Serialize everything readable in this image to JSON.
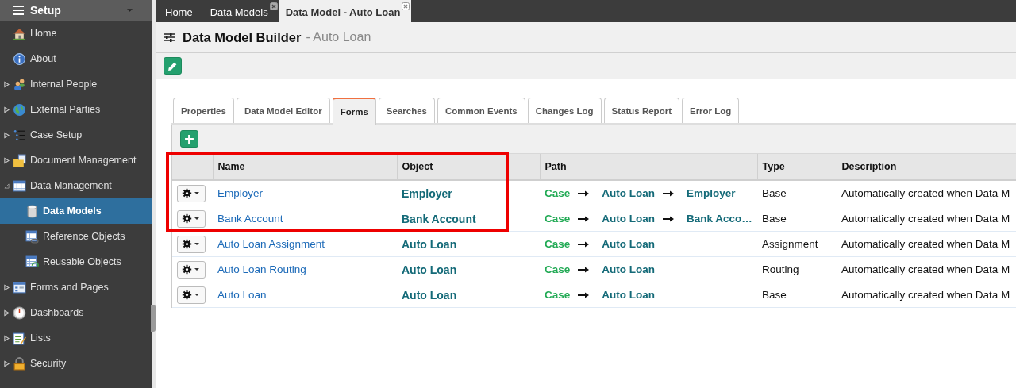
{
  "sidebar": {
    "title": "Setup",
    "items": [
      {
        "label": "Home",
        "kind": "link",
        "selected": false
      },
      {
        "label": "About",
        "kind": "link",
        "selected": false
      },
      {
        "label": "Internal People",
        "kind": "group",
        "expanded": false,
        "selected": false
      },
      {
        "label": "External Parties",
        "kind": "group",
        "expanded": false,
        "selected": false
      },
      {
        "label": "Case Setup",
        "kind": "group",
        "expanded": false,
        "selected": false
      },
      {
        "label": "Document Management",
        "kind": "group",
        "expanded": false,
        "selected": false
      },
      {
        "label": "Data Management",
        "kind": "group",
        "expanded": true,
        "selected": false,
        "children": [
          {
            "label": "Data Models",
            "selected": true
          },
          {
            "label": "Reference Objects",
            "selected": false
          },
          {
            "label": "Reusable Objects",
            "selected": false
          }
        ]
      },
      {
        "label": "Forms and Pages",
        "kind": "group",
        "expanded": false,
        "selected": false
      },
      {
        "label": "Dashboards",
        "kind": "group",
        "expanded": false,
        "selected": false
      },
      {
        "label": "Lists",
        "kind": "group",
        "expanded": false,
        "selected": false
      },
      {
        "label": "Security",
        "kind": "group",
        "expanded": false,
        "selected": false
      }
    ]
  },
  "top_tabs": [
    {
      "label": "Home",
      "closable": false,
      "selected": false
    },
    {
      "label": "Data Models",
      "closable": true,
      "selected": false
    },
    {
      "label": "Data Model - Auto Loan",
      "closable": true,
      "selected": true
    }
  ],
  "header": {
    "title": "Data Model Builder",
    "subtitle": "- Auto Loan"
  },
  "tabs": [
    {
      "label": "Properties",
      "selected": false
    },
    {
      "label": "Data Model Editor",
      "selected": false
    },
    {
      "label": "Forms",
      "selected": true
    },
    {
      "label": "Searches",
      "selected": false
    },
    {
      "label": "Common Events",
      "selected": false
    },
    {
      "label": "Changes Log",
      "selected": false
    },
    {
      "label": "Status Report",
      "selected": false
    },
    {
      "label": "Error Log",
      "selected": false
    }
  ],
  "table": {
    "columns": [
      "Name",
      "Object",
      "Path",
      "Type",
      "Description"
    ],
    "rows": [
      {
        "name": "Employer",
        "object": "Employer",
        "path": [
          {
            "text": "Case",
            "kind": "case"
          },
          {
            "text": "Auto Loan",
            "kind": "object"
          },
          {
            "text": "Employer",
            "kind": "object"
          }
        ],
        "type": "Base",
        "description": "Automatically created when Data M"
      },
      {
        "name": "Bank Account",
        "object": "Bank Account",
        "path": [
          {
            "text": "Case",
            "kind": "case"
          },
          {
            "text": "Auto Loan",
            "kind": "object"
          },
          {
            "text": "Bank Acco…",
            "kind": "object"
          }
        ],
        "type": "Base",
        "description": "Automatically created when Data M"
      },
      {
        "name": "Auto Loan Assignment",
        "object": "Auto Loan",
        "path": [
          {
            "text": "Case",
            "kind": "case"
          },
          {
            "text": "Auto Loan",
            "kind": "object"
          }
        ],
        "type": "Assignment",
        "description": "Automatically created when Data M"
      },
      {
        "name": "Auto Loan Routing",
        "object": "Auto Loan",
        "path": [
          {
            "text": "Case",
            "kind": "case"
          },
          {
            "text": "Auto Loan",
            "kind": "object"
          }
        ],
        "type": "Routing",
        "description": "Automatically created when Data M"
      },
      {
        "name": "Auto Loan",
        "object": "Auto Loan",
        "path": [
          {
            "text": "Case",
            "kind": "case"
          },
          {
            "text": "Auto Loan",
            "kind": "object"
          }
        ],
        "type": "Base",
        "description": "Automatically created when Data M"
      }
    ]
  }
}
